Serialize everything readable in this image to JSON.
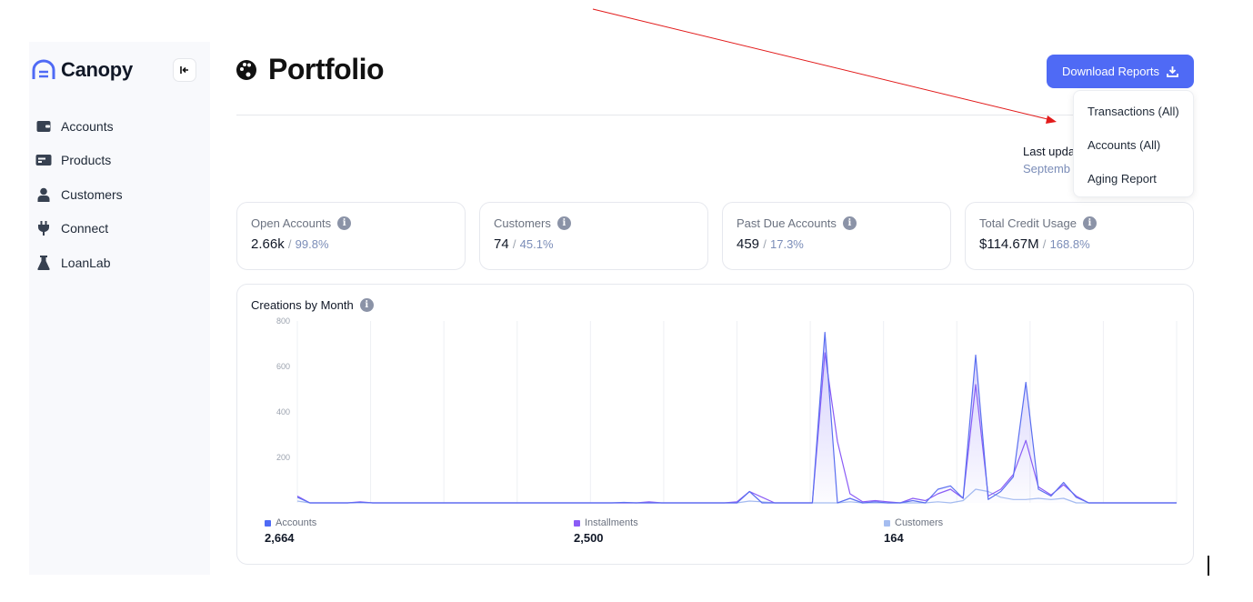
{
  "app": {
    "name": "Canopy"
  },
  "sidebar": {
    "items": [
      {
        "label": "Accounts",
        "icon": "wallet-icon"
      },
      {
        "label": "Products",
        "icon": "card-icon"
      },
      {
        "label": "Customers",
        "icon": "user-icon"
      },
      {
        "label": "Connect",
        "icon": "plug-icon"
      },
      {
        "label": "LoanLab",
        "icon": "flask-icon"
      }
    ]
  },
  "header": {
    "title": "Portfolio",
    "download_label": "Download Reports",
    "last_updated_label": "Last upda",
    "last_updated_value": "Septemb"
  },
  "dropdown": {
    "items": [
      "Transactions (All)",
      "Accounts (All)",
      "Aging Report"
    ]
  },
  "stats": [
    {
      "label": "Open Accounts",
      "value": "2.66k",
      "sep": "/",
      "pct": "99.8%"
    },
    {
      "label": "Customers",
      "value": "74",
      "sep": "/",
      "pct": "45.1%"
    },
    {
      "label": "Past Due Accounts",
      "value": "459",
      "sep": "/",
      "pct": "17.3%"
    },
    {
      "label": "Total Credit Usage",
      "value": "$114.67M",
      "sep": "/",
      "pct": "168.8%"
    }
  ],
  "colors": {
    "accent": "#4f6af5",
    "accounts": "#5b6ff0",
    "installments": "#8b5cf6",
    "customers": "#a5bdf0"
  },
  "chart_data": {
    "type": "area",
    "title": "Creations by Month",
    "xlabel": "",
    "ylabel": "",
    "ylim": [
      0,
      800
    ],
    "yticks": [
      200,
      400,
      600,
      800
    ],
    "grid": true,
    "legend_placement": "bottom",
    "series": [
      {
        "name": "Accounts",
        "total": "2,664",
        "color": "#5b6ff0",
        "values": [
          25,
          0,
          0,
          0,
          0,
          2,
          0,
          0,
          0,
          0,
          0,
          0,
          0,
          0,
          0,
          0,
          0,
          0,
          0,
          0,
          0,
          0,
          0,
          0,
          0,
          0,
          2,
          0,
          0,
          0,
          0,
          0,
          0,
          0,
          0,
          0,
          50,
          0,
          0,
          0,
          0,
          0,
          750,
          0,
          20,
          0,
          5,
          0,
          0,
          10,
          0,
          60,
          75,
          20,
          650,
          15,
          50,
          115,
          530,
          60,
          30,
          90,
          25,
          0,
          0,
          0,
          0,
          0,
          0,
          0,
          0
        ]
      },
      {
        "name": "Installments",
        "total": "2,500",
        "color": "#8b5cf6",
        "values": [
          30,
          0,
          0,
          0,
          0,
          5,
          0,
          0,
          0,
          0,
          0,
          0,
          0,
          0,
          0,
          0,
          0,
          0,
          0,
          0,
          0,
          0,
          0,
          0,
          0,
          0,
          0,
          0,
          5,
          0,
          0,
          0,
          0,
          0,
          0,
          5,
          50,
          25,
          0,
          0,
          0,
          0,
          660,
          270,
          40,
          5,
          10,
          5,
          0,
          20,
          10,
          40,
          60,
          20,
          520,
          30,
          60,
          125,
          275,
          70,
          35,
          80,
          30,
          0,
          0,
          0,
          0,
          0,
          0,
          0,
          0
        ]
      },
      {
        "name": "Customers",
        "total": "164",
        "color": "#a5bdf0",
        "values": [
          8,
          0,
          0,
          0,
          0,
          2,
          0,
          0,
          0,
          0,
          0,
          0,
          0,
          0,
          0,
          0,
          0,
          0,
          0,
          0,
          0,
          0,
          0,
          0,
          0,
          0,
          0,
          0,
          0,
          0,
          0,
          0,
          0,
          0,
          0,
          0,
          8,
          5,
          0,
          0,
          0,
          0,
          0,
          0,
          5,
          0,
          0,
          0,
          0,
          0,
          0,
          5,
          0,
          10,
          60,
          50,
          25,
          15,
          15,
          20,
          15,
          20,
          0,
          0,
          0,
          0,
          0,
          0,
          0,
          0,
          0
        ]
      }
    ]
  }
}
